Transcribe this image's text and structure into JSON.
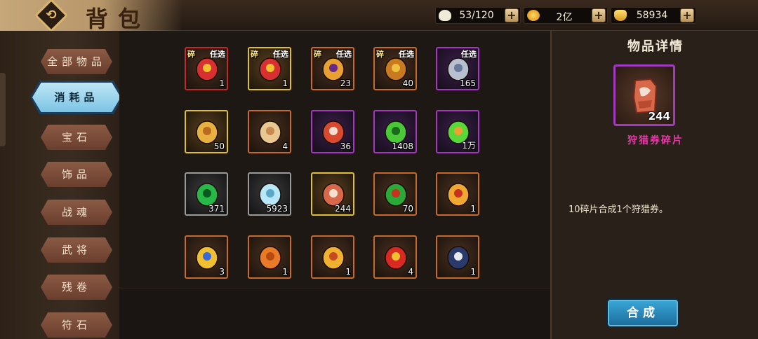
{
  "header": {
    "title": "背包",
    "back_icon": "back-arrow-icon",
    "resources": [
      {
        "name": "bag-capacity",
        "icon": "bun-icon",
        "value": "53/120",
        "color": "#f0ead8"
      },
      {
        "name": "gold",
        "icon": "gold-coin-icon",
        "value": "2亿",
        "color": "#f0b030"
      },
      {
        "name": "ingot",
        "icon": "gold-ingot-icon",
        "value": "58934",
        "color": "#f2c040"
      }
    ],
    "plus_label": "+"
  },
  "sidebar": {
    "tabs": [
      {
        "label": "全部物品",
        "active": false
      },
      {
        "label": "消耗品",
        "active": true
      },
      {
        "label": "宝石",
        "active": false
      },
      {
        "label": "饰品",
        "active": false
      },
      {
        "label": "战魂",
        "active": false
      },
      {
        "label": "武将",
        "active": false
      },
      {
        "label": "残卷",
        "active": false
      },
      {
        "label": "符石",
        "active": false
      }
    ]
  },
  "grid": {
    "items": [
      {
        "icon": "red-crown-chest-icon",
        "count": "1",
        "border": "red",
        "frag": "碎",
        "choice": "任选"
      },
      {
        "icon": "gold-crown-chest-icon",
        "count": "1",
        "border": "gold",
        "frag": "碎",
        "choice": "任选"
      },
      {
        "icon": "purple-treasure-chest-icon",
        "count": "23",
        "border": "orange",
        "frag": "碎",
        "choice": "任选"
      },
      {
        "icon": "gold-treasure-chest-icon",
        "count": "40",
        "border": "orange",
        "frag": "碎",
        "choice": "任选"
      },
      {
        "icon": "silver-treasure-chest-icon",
        "count": "165",
        "border": "purple",
        "frag": "",
        "choice": "任选"
      },
      {
        "icon": "gold-shield-fragment-icon",
        "count": "50",
        "border": "gold",
        "frag": "",
        "choice": ""
      },
      {
        "icon": "scroll-icon",
        "count": "4",
        "border": "orange",
        "frag": "",
        "choice": ""
      },
      {
        "icon": "puzzle-piece-icon",
        "count": "36",
        "border": "purple",
        "frag": "",
        "choice": ""
      },
      {
        "icon": "green-orb-icon",
        "count": "1408",
        "border": "purple",
        "frag": "",
        "choice": ""
      },
      {
        "icon": "paw-orb-icon",
        "count": "1万",
        "border": "purple",
        "frag": "",
        "choice": ""
      },
      {
        "icon": "green-gem-icon",
        "count": "371",
        "border": "grey",
        "frag": "",
        "choice": ""
      },
      {
        "icon": "crystal-shard-icon",
        "count": "5923",
        "border": "grey",
        "frag": "",
        "choice": ""
      },
      {
        "icon": "hunting-ticket-fragment-icon",
        "count": "244",
        "border": "gold",
        "frag": "",
        "choice": ""
      },
      {
        "icon": "jade-knot-icon",
        "count": "70",
        "border": "orange",
        "frag": "",
        "choice": ""
      },
      {
        "icon": "bell-icon",
        "count": "1",
        "border": "orange",
        "frag": "",
        "choice": ""
      },
      {
        "icon": "medal-icon",
        "count": "3",
        "border": "orange",
        "frag": "",
        "choice": ""
      },
      {
        "icon": "mooncake-icon",
        "count": "1",
        "border": "orange",
        "frag": "",
        "choice": ""
      },
      {
        "icon": "star-coin-icon",
        "count": "1",
        "border": "orange",
        "frag": "",
        "choice": ""
      },
      {
        "icon": "firecracker-icon",
        "count": "4",
        "border": "orange",
        "frag": "",
        "choice": ""
      },
      {
        "icon": "magpie-icon",
        "count": "1",
        "border": "orange",
        "frag": "",
        "choice": ""
      }
    ]
  },
  "detail": {
    "title": "物品详情",
    "item_icon": "hunting-ticket-fragment-icon",
    "item_count": "244",
    "item_name": "狩猎券碎片",
    "description": "10碎片合成1个狩猎券。",
    "compose_label": "合成"
  }
}
